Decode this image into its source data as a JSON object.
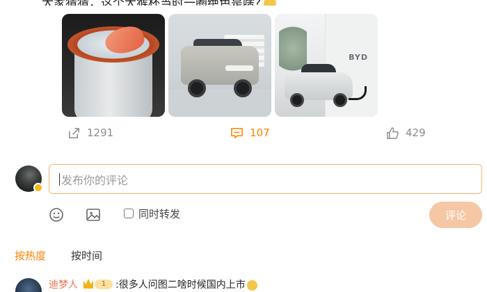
{
  "post": {
    "text_clipped": "大家猜猜，这个大猴杯当时一圈绝色是啥?"
  },
  "actions": {
    "share": {
      "icon": "share-icon",
      "count": "1291"
    },
    "comment": {
      "icon": "comment-icon",
      "count": "107"
    },
    "like": {
      "icon": "thumbs-up-icon",
      "count": "429"
    }
  },
  "compose": {
    "placeholder": "发布你的评论",
    "repost_label": "同时转发",
    "submit_label": "评论"
  },
  "sort": {
    "hot_label": "按热度",
    "time_label": "按时间",
    "active": "hot"
  },
  "comments": [
    {
      "user": "迪梦人",
      "level": "1",
      "text": ":很多人问图二啥时候国内上市"
    }
  ],
  "image_texts": {
    "showroom_sign": "BYD"
  },
  "colors": {
    "accent": "#ff8200",
    "input_border": "#f3b473",
    "submit_bg": "#f6c7a4",
    "username": "#eb7350"
  }
}
